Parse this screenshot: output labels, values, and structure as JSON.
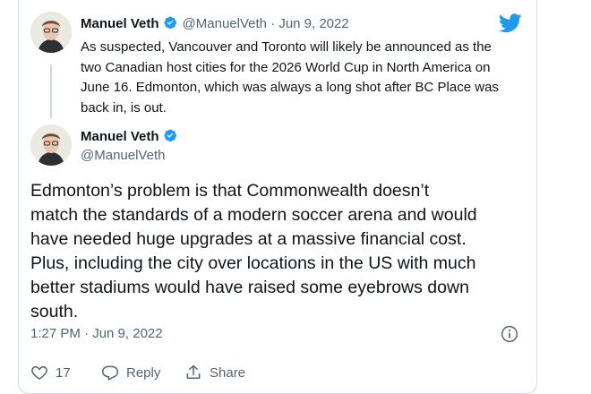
{
  "quoted": {
    "display_name": "Manuel Veth",
    "meta": "@ManuelVeth · Jun 9, 2022",
    "lines": [
      "As suspected, Vancouver and Toronto will likely be announced as the",
      "two Canadian host cities for the 2026 World Cup in North America on",
      "June 16. Edmonton, which was always a long shot after BC Place was",
      "back in, is out."
    ]
  },
  "tweet": {
    "display_name": "Manuel Veth",
    "handle": "@ManuelVeth",
    "lines": [
      "Edmonton’s problem is that Commonwealth doesn’t",
      "match the standards of a modern soccer arena and would",
      "have needed huge upgrades at a massive financial cost.",
      "Plus, including the city over locations in the US with much",
      "better stadiums would have raised some eyebrows down",
      "south."
    ],
    "timestamp": "1:27 PM · Jun 9, 2022"
  },
  "actions": {
    "like_count": "17",
    "reply_label": "Reply",
    "share_label": "Share"
  },
  "colors": {
    "brand": "#1d9bf0",
    "text": "#0f1419",
    "secondary": "#536471",
    "border": "#cfd9de"
  },
  "icons": [
    "twitter-bird-icon",
    "verified-badge-icon",
    "info-icon",
    "heart-icon",
    "reply-icon",
    "share-icon"
  ]
}
